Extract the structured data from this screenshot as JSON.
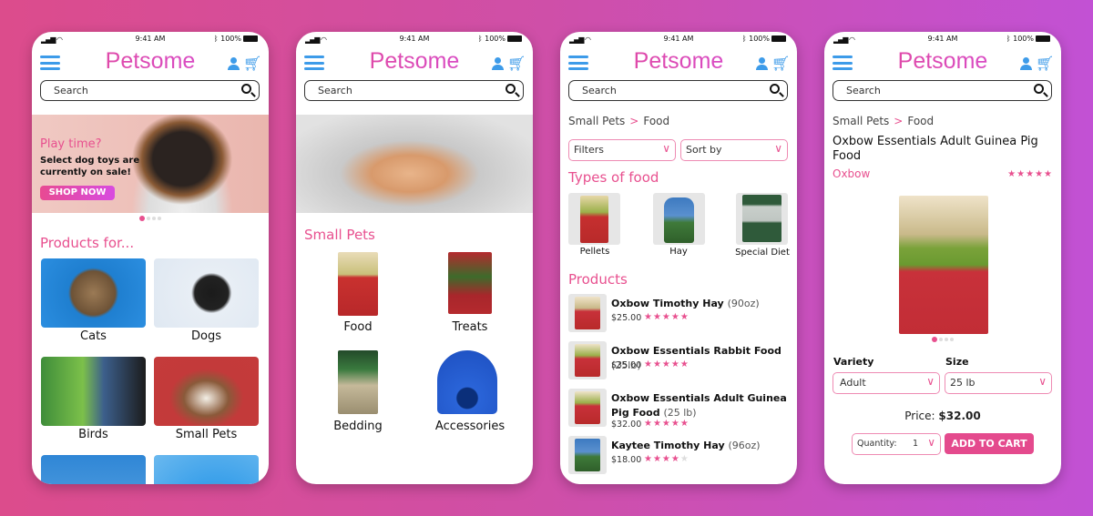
{
  "common": {
    "time": "9:41 AM",
    "battery": "100%",
    "brand": "Petsome",
    "search_placeholder": "Search"
  },
  "colors": {
    "accent": "#e8508f",
    "icons": "#3d9be9",
    "brand_gradient": [
      "#e44a95",
      "#d44bd8"
    ]
  },
  "home": {
    "banner": {
      "kicker": "Play time?",
      "text": "Select dog toys are currently on sale!",
      "cta": "SHOP NOW"
    },
    "carousel": {
      "pages": 4,
      "active": 1
    },
    "section_title": "Products for...",
    "categories": [
      {
        "label": "Cats"
      },
      {
        "label": "Dogs"
      },
      {
        "label": "Birds"
      },
      {
        "label": "Small Pets"
      }
    ]
  },
  "category": {
    "title": "Small Pets",
    "items": [
      {
        "label": "Food"
      },
      {
        "label": "Treats"
      },
      {
        "label": "Bedding"
      },
      {
        "label": "Accessories"
      }
    ]
  },
  "listing": {
    "breadcrumb": [
      "Small Pets",
      "Food"
    ],
    "filters_label": "Filters",
    "sort_label": "Sort by",
    "types_title": "Types of food",
    "types": [
      {
        "label": "Pellets"
      },
      {
        "label": "Hay"
      },
      {
        "label": "Special Diet"
      }
    ],
    "products_title": "Products",
    "products": [
      {
        "name": "Oxbow Timothy Hay",
        "size": "(90oz)",
        "price": "$25.00",
        "rating": 5
      },
      {
        "name": "Oxbow Essentials Rabbit Food",
        "size": "(25lb)",
        "price": "$35.00",
        "rating": 5
      },
      {
        "name": "Oxbow Essentials Adult Guinea Pig Food",
        "size": "(25 lb)",
        "price": "$32.00",
        "rating": 5
      },
      {
        "name": "Kaytee Timothy Hay",
        "size": "(96oz)",
        "price": "$18.00",
        "rating": 4
      }
    ]
  },
  "detail": {
    "breadcrumb": [
      "Small Pets",
      "Food"
    ],
    "title": "Oxbow Essentials Adult Guinea Pig Food",
    "brand": "Oxbow",
    "rating": 5,
    "gallery": {
      "pages": 4,
      "active": 1
    },
    "variety_label": "Variety",
    "variety_value": "Adult",
    "size_label": "Size",
    "size_value": "25 lb",
    "price_label": "Price:",
    "price": "$32.00",
    "quantity_label": "Quantity:",
    "quantity": "1",
    "add_to_cart": "ADD TO CART"
  }
}
